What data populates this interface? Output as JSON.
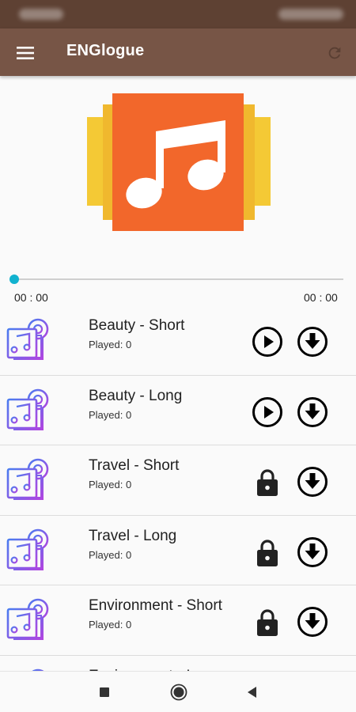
{
  "app": {
    "title": "ENGlogue"
  },
  "player": {
    "time_elapsed": "00 : 00",
    "time_total": "00 : 00",
    "progress": 0
  },
  "tracks": [
    {
      "title": "Beauty - Short",
      "played": "Played: 0",
      "locked": false
    },
    {
      "title": "Beauty - Long",
      "played": "Played: 0",
      "locked": false
    },
    {
      "title": "Travel - Short",
      "played": "Played: 0",
      "locked": true
    },
    {
      "title": "Travel - Long",
      "played": "Played: 0",
      "locked": true
    },
    {
      "title": "Environment - Short",
      "played": "Played: 0",
      "locked": true
    },
    {
      "title": "Environment - Long",
      "played": "",
      "locked": true
    }
  ],
  "colors": {
    "status_bar": "#5e4133",
    "app_bar": "#775546",
    "accent": "#11b2cf",
    "album_orange": "#f2672b",
    "album_yellow": "#f4c935"
  },
  "icons": {
    "menu": "hamburger-menu-icon",
    "refresh": "refresh-icon",
    "album": "music-note-icon",
    "track": "music-album-icon",
    "play": "play-circle-icon",
    "lock": "lock-icon",
    "download": "download-circle-icon",
    "nav_recents": "square-icon",
    "nav_home": "circle-icon",
    "nav_back": "back-triangle-icon"
  }
}
